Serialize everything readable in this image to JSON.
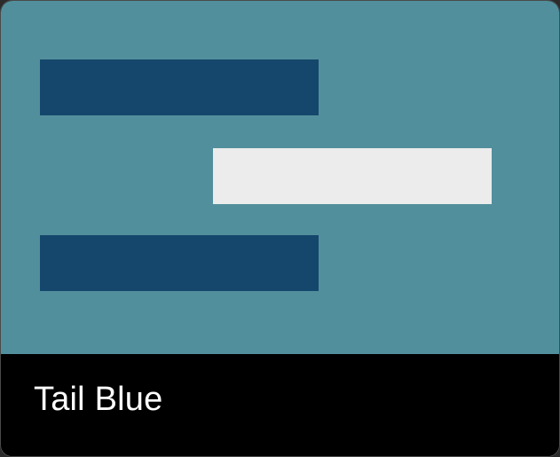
{
  "card": {
    "title": "Tail Blue",
    "colors": {
      "preview_background": "#528f9c",
      "bar_dark": "#15476c",
      "bar_light": "#ececec",
      "footer_background": "#000000",
      "title_text": "#ffffff"
    }
  }
}
